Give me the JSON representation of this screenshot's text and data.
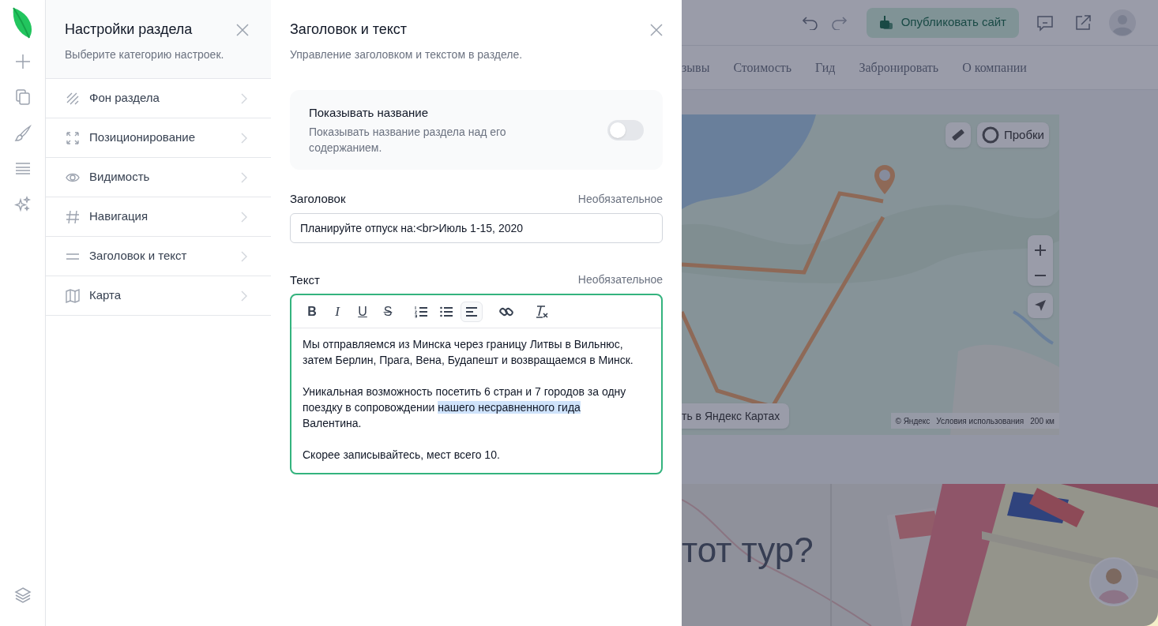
{
  "settings_panel": {
    "title": "Настройки раздела",
    "subtitle": "Выберите категорию настроек.",
    "items": [
      {
        "kind": "background",
        "label": "Фон раздела"
      },
      {
        "kind": "position",
        "label": "Позиционирование"
      },
      {
        "kind": "visibility",
        "label": "Видимость"
      },
      {
        "kind": "navigation",
        "label": "Навигация"
      },
      {
        "kind": "text",
        "label": "Заголовок и текст"
      },
      {
        "kind": "map",
        "label": "Карта"
      }
    ]
  },
  "editor_panel": {
    "title": "Заголовок и текст",
    "subtitle": "Управление заголовком и текстом в разделе.",
    "show_title": {
      "label": "Показывать название",
      "description": "Показывать название раздела над его содержанием.",
      "on": false
    },
    "heading_field": {
      "label": "Заголовок",
      "hint": "Необязательное",
      "value": "Планируйте отпуск на:<br>Июль 1-15, 2020"
    },
    "text_field": {
      "label": "Текст",
      "hint": "Необязательное",
      "toolbar": [
        {
          "kind": "bold",
          "label": "B",
          "active": false
        },
        {
          "kind": "italic",
          "label": "I",
          "active": false
        },
        {
          "kind": "underline",
          "label": "U",
          "active": false
        },
        {
          "kind": "strike",
          "label": "S",
          "active": false
        },
        {
          "kind": "ordered-list",
          "active": false
        },
        {
          "kind": "bullet-list",
          "active": false
        },
        {
          "kind": "align-left",
          "active": true
        },
        {
          "kind": "link",
          "active": false
        },
        {
          "kind": "clear-format",
          "active": false
        }
      ],
      "paragraphs": [
        [
          {
            "text": "Мы отправляемся из Минска через границу Литвы в Вильнюс, затем Берлин, Прага, Вена, Будапешт и возвращаемся в Минск.",
            "selected": false
          }
        ],
        [
          {
            "text": "Уникальная возможность посетить 6 стран и 7 городов за одну поездку в сопровождении ",
            "selected": false
          },
          {
            "text": "нашего несравненного гида ",
            "selected": true
          },
          {
            "text": "Валентина.",
            "selected": false
          }
        ],
        [
          {
            "text": "Скорее записывайтесь, мест всего 10.",
            "selected": false
          }
        ]
      ]
    }
  },
  "site_preview": {
    "publish_button": "Опубликовать сайт",
    "nav": [
      "зывы",
      "Стоимость",
      "Гид",
      "Забронировать",
      "О компании"
    ],
    "map": {
      "traffic_button": "Пробки",
      "open_button": "ть в Яндекс Картах",
      "copyright": "© Яндекс",
      "terms": "Условия использования",
      "scale": "200 км"
    },
    "heading": "тот тур?"
  }
}
